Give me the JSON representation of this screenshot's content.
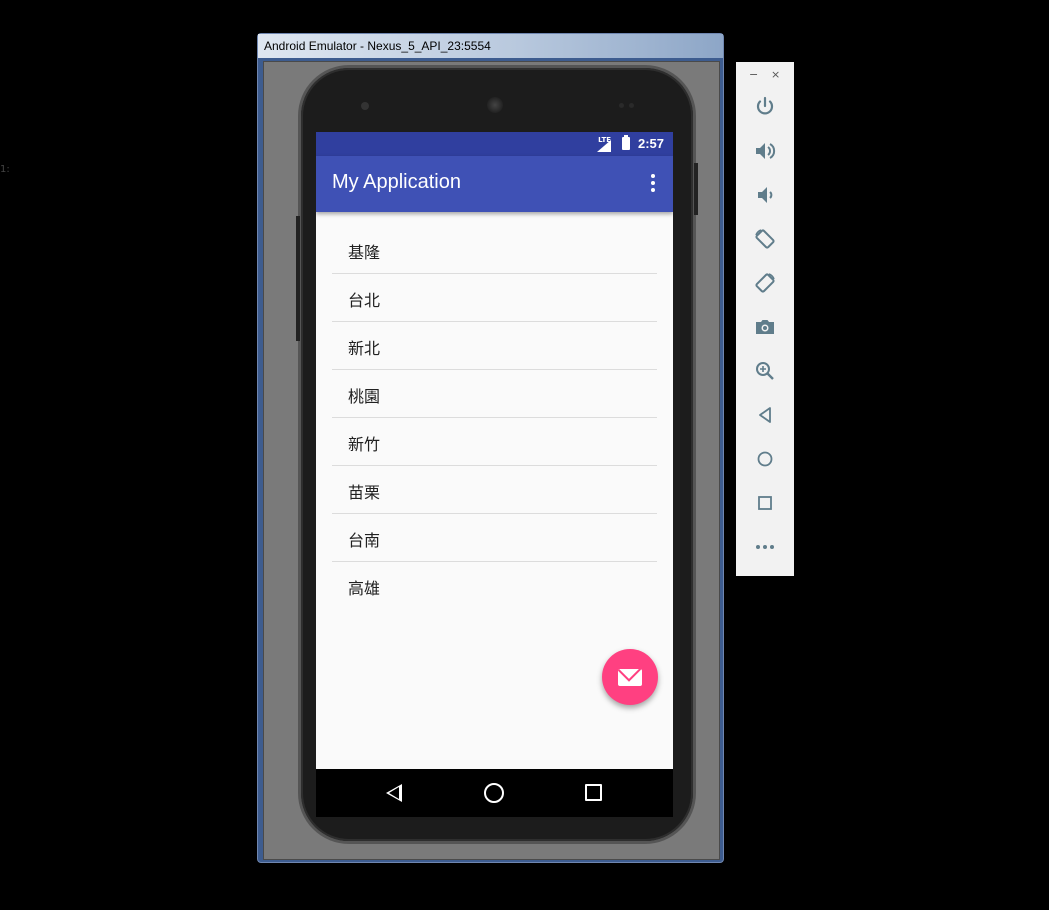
{
  "window": {
    "title": "Android Emulator - Nexus_5_API_23:5554"
  },
  "status_bar": {
    "network": "LTE",
    "time": "2:57"
  },
  "app_bar": {
    "title": "My Application"
  },
  "list": {
    "items": [
      {
        "label": "基隆"
      },
      {
        "label": "台北"
      },
      {
        "label": "新北"
      },
      {
        "label": "桃園"
      },
      {
        "label": "新竹"
      },
      {
        "label": "苗栗"
      },
      {
        "label": "台南"
      },
      {
        "label": "高雄"
      }
    ]
  },
  "fab": {
    "icon": "mail-icon",
    "color": "#ff4081"
  },
  "nav_bar": {
    "icons": [
      "back-icon",
      "home-icon",
      "recent-apps-icon"
    ]
  },
  "control_panel": {
    "window_buttons": {
      "minimize": "−",
      "close": "×"
    },
    "controls": [
      "power-icon",
      "volume-up-icon",
      "volume-down-icon",
      "rotate-left-icon",
      "rotate-right-icon",
      "camera-icon",
      "zoom-icon",
      "back-icon",
      "home-icon",
      "overview-icon",
      "more-icon"
    ]
  },
  "colors": {
    "primary": "#3f51b5",
    "primary_dark": "#303f9f",
    "accent": "#ff4081"
  },
  "side_mark": "1:"
}
